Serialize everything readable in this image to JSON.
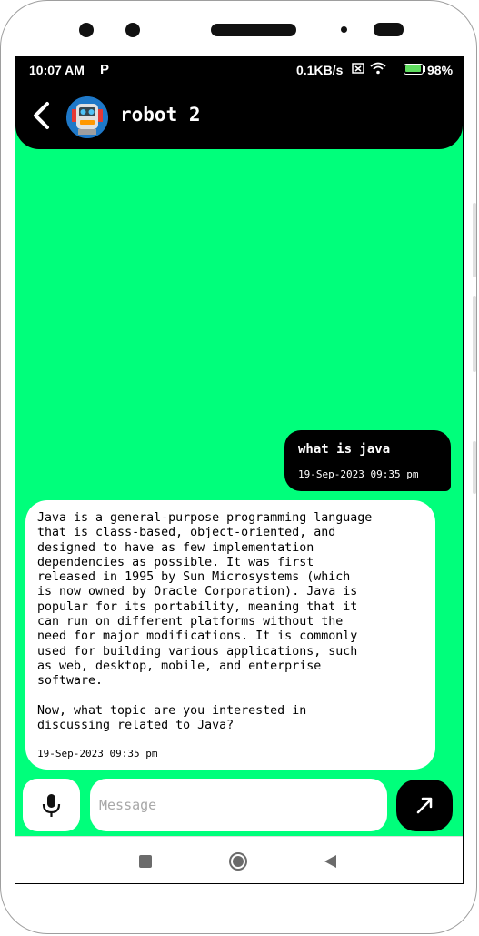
{
  "status_bar": {
    "time": "10:07 AM",
    "notification_icon": "P",
    "net_speed": "0.1KB/s",
    "battery_percent": "98%",
    "battery_level": 0.98
  },
  "header": {
    "title": "robot 2",
    "back_icon": "back-arrow-icon",
    "avatar_icon": "robot-avatar-icon"
  },
  "messages": [
    {
      "sender": "user",
      "text": "what is java",
      "timestamp": "19-Sep-2023 09:35 pm"
    },
    {
      "sender": "bot",
      "text": "Java is a general-purpose programming language\nthat is class-based, object-oriented, and\ndesigned to have as few implementation\ndependencies as possible. It was first\nreleased in 1995 by Sun Microsystems (which\nis now owned by Oracle Corporation). Java is\npopular for its portability, meaning that it\ncan run on different platforms without the\nneed for major modifications. It is commonly\nused for building various applications, such\nas web, desktop, mobile, and enterprise\nsoftware.\n\nNow, what topic are you interested in\ndiscussing related to Java?",
      "timestamp": "19-Sep-2023 09:35 pm"
    }
  ],
  "composer": {
    "placeholder": "Message",
    "value": "",
    "mic_icon": "microphone-icon",
    "send_icon": "send-arrow-icon"
  },
  "colors": {
    "chat_background": "#00ff7b",
    "appbar": "#000000",
    "user_bubble": "#000000",
    "bot_bubble": "#ffffff"
  }
}
